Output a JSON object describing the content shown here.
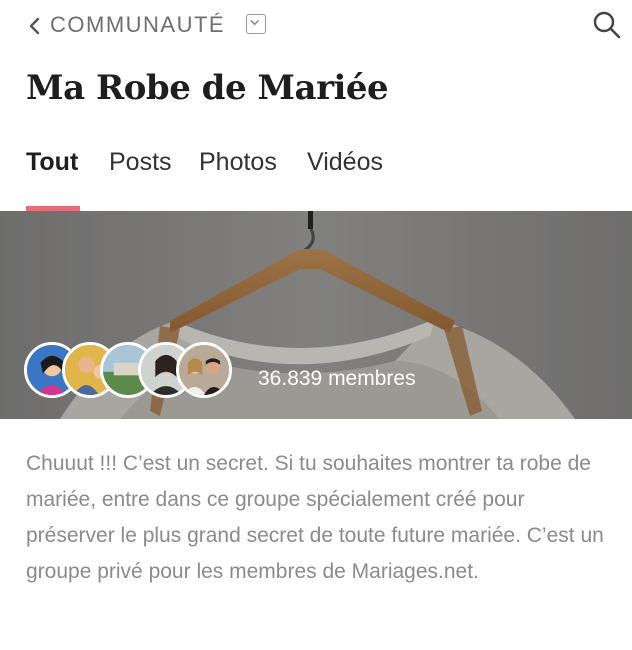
{
  "header": {
    "back_icon": "chevron-left-icon",
    "breadcrumb": "COMMUNAUTÉ",
    "dropdown_icon": "chevron-down-icon",
    "search_icon": "search-icon"
  },
  "group": {
    "title": "Ma Robe de Mariée"
  },
  "tabs": [
    {
      "label": "Tout",
      "active": true
    },
    {
      "label": "Posts",
      "active": false
    },
    {
      "label": "Photos",
      "active": false
    },
    {
      "label": "Vidéos",
      "active": false
    }
  ],
  "hero": {
    "members_text": "36.839 membres",
    "avatar_count": 5
  },
  "description": "Chuuut !!! C’est un secret. Si tu souhaites montrer ta robe de mariée, entre dans ce groupe spécialement créé pour préserver le plus grand secret de toute future mariée. C’est un groupe privé pour les membres de Mariages.net.",
  "colors": {
    "accent": "#e46e78",
    "muted_text": "#8b8b8b"
  }
}
